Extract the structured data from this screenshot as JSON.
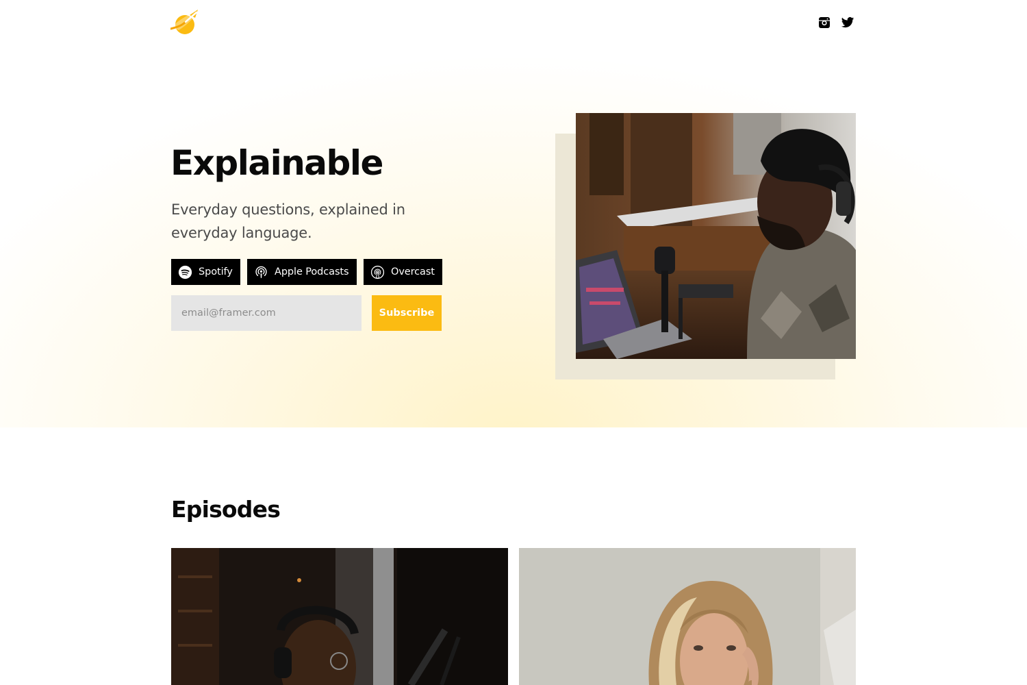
{
  "header": {
    "logo_icon": "planet-rocket-logo-icon",
    "social": [
      {
        "icon": "instagram-icon",
        "label": "Instagram"
      },
      {
        "icon": "twitter-icon",
        "label": "Twitter"
      }
    ]
  },
  "hero": {
    "title": "Explainable",
    "subtitle": "Everyday questions, explained in everyday language.",
    "platforms": [
      {
        "label": "Spotify",
        "icon": "spotify-icon"
      },
      {
        "label": "Apple Podcasts",
        "icon": "apple-podcasts-icon"
      },
      {
        "label": "Overcast",
        "icon": "overcast-icon"
      }
    ],
    "email_placeholder": "email@framer.com",
    "email_value": "",
    "subscribe_label": "Subscribe",
    "photo": "man-with-headphones-at-microphone-photo"
  },
  "episodes": {
    "title": "Episodes",
    "cards": [
      {
        "image": "man-with-headphones-and-glasses-photo"
      },
      {
        "image": "woman-with-blonde-hair-photo"
      }
    ]
  },
  "colors": {
    "accent": "#fbbb12",
    "button_bg": "#000000",
    "input_bg": "#e5e5e5",
    "hero_glow": "#fff3c8",
    "photo_shadow": "#ece7d6"
  }
}
